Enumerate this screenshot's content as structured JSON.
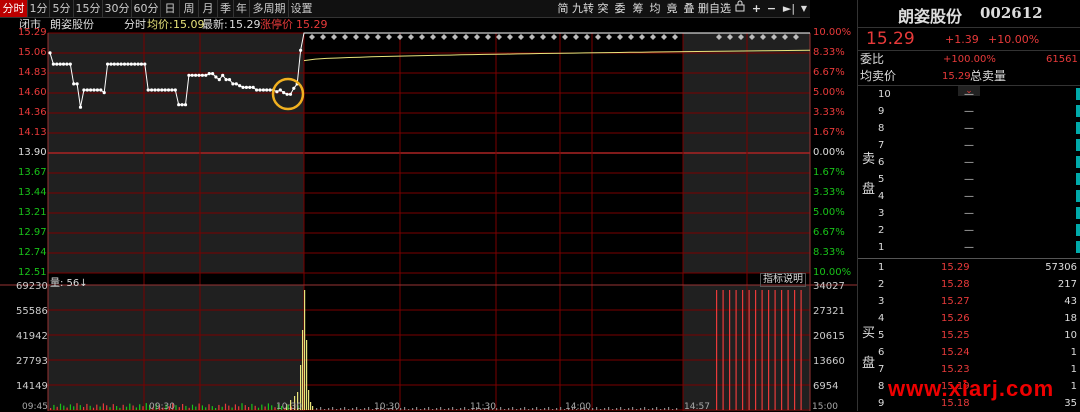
{
  "toolbar": {
    "tabs": [
      "分时",
      "1分",
      "5分",
      "15分",
      "30分",
      "60分",
      "日",
      "周",
      "月",
      "季",
      "年",
      "多周期",
      "设置"
    ],
    "active_tab": "分时",
    "right_buttons": [
      "简",
      "九转",
      "突",
      "委",
      "筹",
      "均",
      "竟",
      "叠",
      "删自选"
    ]
  },
  "chart": {
    "status": "闭市",
    "stock_name": "朗姿股份",
    "line_label": "分时",
    "avg_label": "均价:",
    "avg_value": "15.09",
    "last_label": "最新:",
    "last_value": "15.29",
    "limit_label": "涨停价",
    "limit_value": "15.29",
    "price_ticks": [
      "15.29",
      "15.06",
      "14.83",
      "14.60",
      "14.36",
      "14.13",
      "13.90",
      "13.67",
      "13.44",
      "13.21",
      "12.97",
      "12.74",
      "12.51"
    ],
    "pct_ticks": [
      "10.00%",
      "8.33%",
      "6.67%",
      "5.00%",
      "3.33%",
      "1.67%",
      "0.00%",
      "1.67%",
      "3.33%",
      "5.00%",
      "6.67%",
      "8.33%",
      "10.00%"
    ],
    "volume_label": "量: 56↓",
    "indicator_label": "指标说明",
    "vol_left_ticks": [
      "69230",
      "55586",
      "41942",
      "27793",
      "14149"
    ],
    "vol_right_ticks": [
      "34027",
      "27321",
      "20615",
      "13660",
      "6954"
    ],
    "time_ticks": [
      "09:45",
      "09:30",
      "10:30",
      "10:30",
      "11:30",
      "14:00",
      "14:57",
      "15:00"
    ],
    "colors": {
      "up": "#e83a3a",
      "down": "#19c219",
      "flat": "#dddddd",
      "grid": "#7a0000",
      "avg_line": "#e8e37a"
    }
  },
  "chart_data": {
    "type": "line",
    "title": "",
    "series": [
      {
        "name": "分时",
        "x_index": [
          0,
          1,
          2,
          3,
          4,
          5,
          6,
          7,
          8,
          9,
          10,
          11,
          12,
          13,
          14,
          15,
          16,
          17,
          18,
          19,
          20,
          21,
          22,
          23,
          24,
          25,
          26,
          27,
          28,
          29,
          30,
          31,
          32,
          33,
          34,
          35,
          36,
          37,
          38,
          39,
          40,
          41,
          42,
          43,
          44,
          45,
          46,
          47,
          48,
          49,
          50,
          51,
          52,
          53,
          54,
          55,
          56,
          57,
          58,
          59,
          60,
          61,
          62,
          63,
          64,
          65,
          66,
          67,
          68,
          69,
          70,
          71,
          72,
          73,
          74,
          75,
          76,
          77,
          78,
          79,
          80,
          81,
          82,
          83,
          84,
          85,
          86,
          87,
          88,
          89,
          90,
          91,
          92,
          93,
          94,
          95,
          96,
          97,
          98,
          99,
          100,
          101,
          102,
          103,
          104,
          105,
          106,
          107,
          108,
          109,
          110,
          111,
          112,
          113,
          114,
          115,
          116,
          117,
          118,
          119,
          120
        ],
        "values": [
          15.06,
          14.93,
          14.93,
          14.93,
          14.93,
          14.93,
          14.93,
          14.7,
          14.7,
          14.43,
          14.63,
          14.63,
          14.63,
          14.63,
          14.63,
          14.63,
          14.6,
          14.93,
          14.93,
          14.93,
          14.93,
          14.93,
          14.93,
          14.93,
          14.93,
          14.93,
          14.93,
          14.93,
          14.93,
          14.63,
          14.63,
          14.63,
          14.63,
          14.63,
          14.63,
          14.63,
          14.63,
          14.63,
          14.46,
          14.46,
          14.46,
          14.8,
          14.8,
          14.8,
          14.8,
          14.8,
          14.8,
          14.82,
          14.82,
          14.78,
          14.75,
          14.8,
          14.75,
          14.75,
          14.7,
          14.7,
          14.68,
          14.66,
          14.66,
          14.66,
          14.66,
          14.63,
          14.63,
          14.63,
          14.63,
          14.63,
          14.63,
          14.61,
          14.63,
          14.6,
          14.58,
          14.58,
          14.65,
          14.7,
          15.09,
          15.29,
          15.29,
          15.29,
          15.29,
          15.29,
          15.29,
          15.29,
          15.29,
          15.29,
          15.29,
          15.29,
          15.29,
          15.29,
          15.29,
          15.29,
          15.29,
          15.29,
          15.29,
          15.29,
          15.29,
          15.29,
          15.29,
          15.29,
          15.29,
          15.29,
          15.29,
          15.29,
          15.29,
          15.29,
          15.29,
          15.29,
          15.29,
          15.29,
          15.29,
          15.29,
          15.29,
          15.29,
          15.29,
          15.29,
          15.29,
          15.29,
          15.29,
          15.29,
          15.29,
          15.29,
          15.29
        ]
      }
    ],
    "ylim": [
      12.51,
      15.29
    ],
    "prev_close": 13.9
  },
  "panel": {
    "name": "朗姿股份",
    "code": "002612",
    "price": "15.29",
    "change": "+1.39",
    "pct": "+10.00%",
    "webi_label": "委比",
    "webi_value": "+100.00%",
    "webi_extra": "61561",
    "avg_label": "均卖价",
    "avg_value": "15.29",
    "total_label": "总卖量",
    "sell_side_label": [
      "卖",
      "盘"
    ],
    "buy_side_label": [
      "买",
      "盘"
    ],
    "sell_rows": [
      {
        "level": "10",
        "price": "—",
        "vol": ""
      },
      {
        "level": "9",
        "price": "—",
        "vol": ""
      },
      {
        "level": "8",
        "price": "—",
        "vol": ""
      },
      {
        "level": "7",
        "price": "—",
        "vol": ""
      },
      {
        "level": "6",
        "price": "—",
        "vol": ""
      },
      {
        "level": "5",
        "price": "—",
        "vol": ""
      },
      {
        "level": "4",
        "price": "—",
        "vol": ""
      },
      {
        "level": "3",
        "price": "—",
        "vol": ""
      },
      {
        "level": "2",
        "price": "—",
        "vol": ""
      },
      {
        "level": "1",
        "price": "—",
        "vol": ""
      }
    ],
    "buy_rows": [
      {
        "level": "1",
        "price": "15.29",
        "vol": "57306"
      },
      {
        "level": "2",
        "price": "15.28",
        "vol": "217"
      },
      {
        "level": "3",
        "price": "15.27",
        "vol": "43"
      },
      {
        "level": "4",
        "price": "15.26",
        "vol": "18"
      },
      {
        "level": "5",
        "price": "15.25",
        "vol": "10"
      },
      {
        "level": "6",
        "price": "15.24",
        "vol": "1"
      },
      {
        "level": "7",
        "price": "15.23",
        "vol": "1"
      },
      {
        "level": "8",
        "price": "15.19",
        "vol": "1"
      },
      {
        "level": "9",
        "price": "15.18",
        "vol": "35"
      }
    ]
  },
  "watermark": "www.xiarj.com"
}
